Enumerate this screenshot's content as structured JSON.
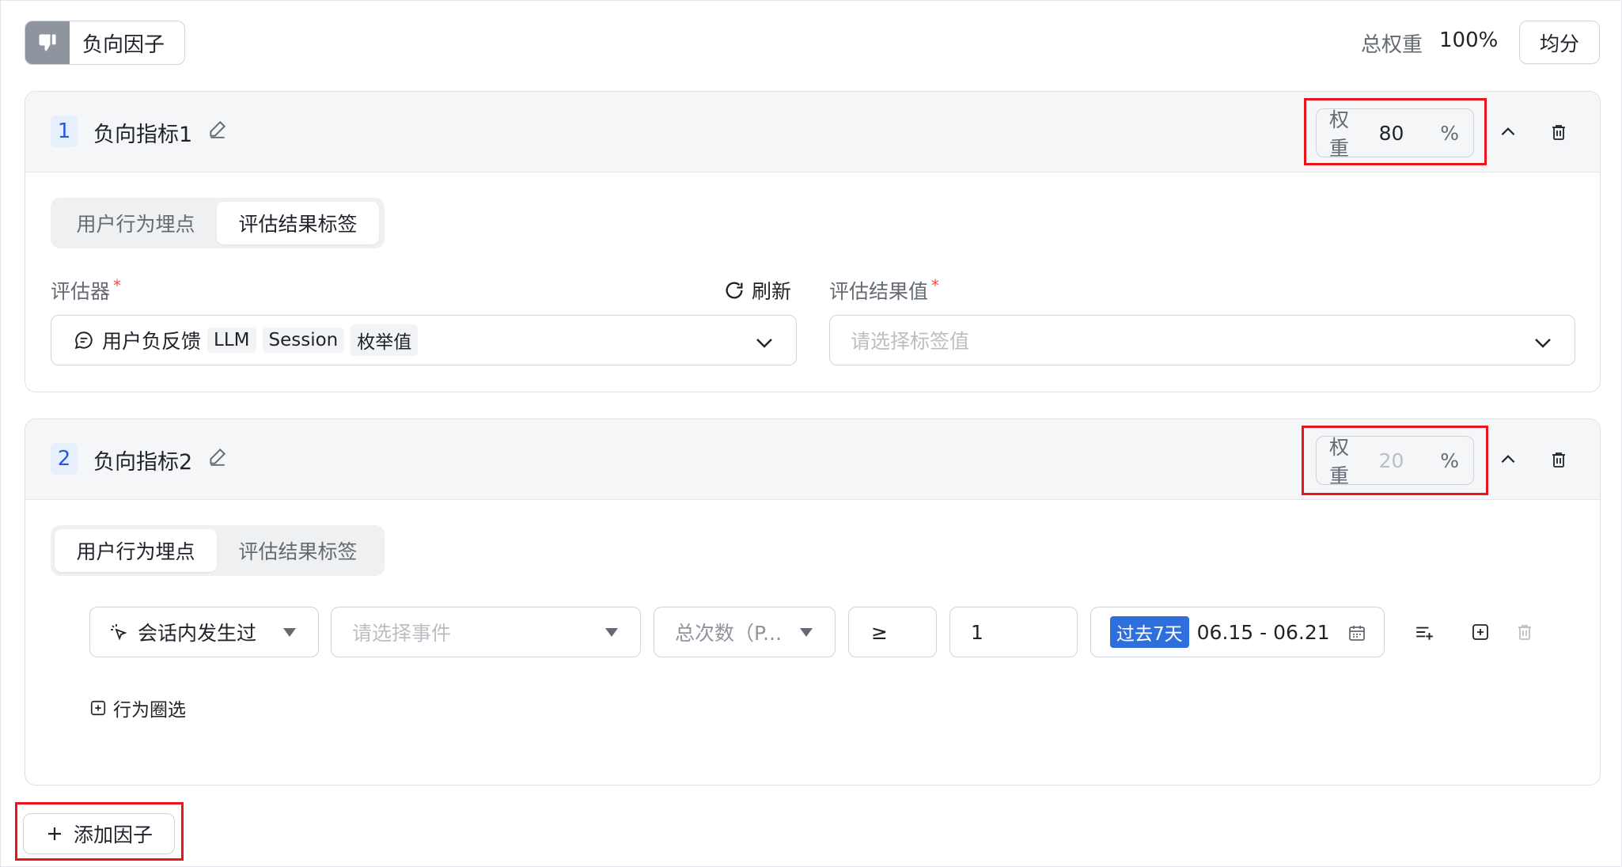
{
  "header": {
    "factor_label": "负向因子",
    "total_weight_label": "总权重",
    "total_weight_value": "100%",
    "even_split_label": "均分"
  },
  "metrics": [
    {
      "index": "1",
      "name": "负向指标1",
      "weight_label": "权重",
      "weight_value": "80",
      "weight_unit": "%",
      "tabs": [
        "用户行为埋点",
        "评估结果标签"
      ],
      "active_tab": 1,
      "evaluator_label": "评估器",
      "refresh_label": "刷新",
      "evaluator_value": "用户负反馈",
      "evaluator_tags": [
        "LLM",
        "Session",
        "枚举值"
      ],
      "result_value_label": "评估结果值",
      "result_value_placeholder": "请选择标签值"
    },
    {
      "index": "2",
      "name": "负向指标2",
      "weight_label": "权重",
      "weight_placeholder": "20",
      "weight_unit": "%",
      "tabs": [
        "用户行为埋点",
        "评估结果标签"
      ],
      "active_tab": 0,
      "condition": {
        "occurrence": "会话内发生过",
        "event_placeholder": "请选择事件",
        "aggregate": "总次数（P...",
        "operator": "≥",
        "value": "1",
        "date_preset": "过去7天",
        "date_range": "06.15 - 06.21"
      },
      "behavior_filter_label": "行为圈选"
    }
  ],
  "add_factor_label": "添加因子",
  "colors": {
    "accent": "#245bdb",
    "date_badge": "#2f6fdb",
    "highlight_box": "#e8151b",
    "required": "#f54a45"
  }
}
